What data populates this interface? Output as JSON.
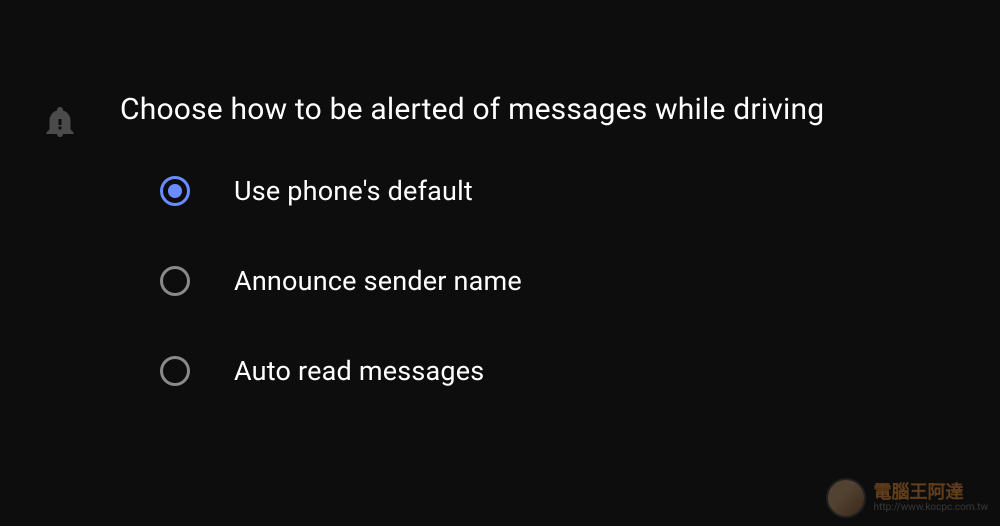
{
  "heading": "Choose how to be alerted of messages while driving",
  "options": [
    {
      "label": "Use phone's default",
      "selected": true
    },
    {
      "label": "Announce sender name",
      "selected": false
    },
    {
      "label": "Auto read messages",
      "selected": false
    }
  ],
  "watermark": {
    "title": "電腦王阿達",
    "url": "http://www.kocpc.com.tw"
  }
}
